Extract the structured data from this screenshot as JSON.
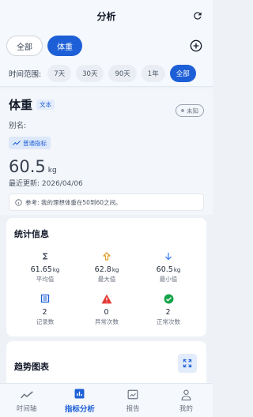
{
  "header": {
    "title": "分析",
    "refresh_icon": "refresh-icon"
  },
  "filters": {
    "tabs": [
      {
        "label": "全部",
        "active": false
      },
      {
        "label": "体重",
        "active": true
      }
    ],
    "add_icon": "add-circle-icon"
  },
  "range": {
    "label": "时间范围:",
    "options": [
      {
        "label": "7天",
        "active": false
      },
      {
        "label": "30天",
        "active": false
      },
      {
        "label": "90天",
        "active": false
      },
      {
        "label": "1年",
        "active": false
      },
      {
        "label": "全部",
        "active": true
      }
    ]
  },
  "indicator": {
    "name": "体重",
    "type_badge": "文本",
    "status": "未知",
    "alias_label": "别名:",
    "category": "普通指标",
    "value": "60.5",
    "unit": "kg",
    "updated": "最近更新: 2026/04/06",
    "note": "参考: 我的理想体重在50到60之间。"
  },
  "stats": {
    "title": "统计信息",
    "items": [
      {
        "icon": "sigma-icon",
        "value": "61.65",
        "unit": "kg",
        "label": "平均值",
        "color": "#4b5563"
      },
      {
        "icon": "arrow-up-icon",
        "value": "62.8",
        "unit": "kg",
        "label": "最大值",
        "color": "#e0a12a"
      },
      {
        "icon": "arrow-down-icon",
        "value": "60.5",
        "unit": "kg",
        "label": "最小值",
        "color": "#3b82f6"
      },
      {
        "icon": "list-icon",
        "value": "2",
        "unit": "",
        "label": "记录数",
        "color": "#1d5fd6"
      },
      {
        "icon": "warning-icon",
        "value": "0",
        "unit": "",
        "label": "异常次数",
        "color": "#e53935"
      },
      {
        "icon": "check-circle-icon",
        "value": "2",
        "unit": "",
        "label": "正常次数",
        "color": "#16a34a"
      }
    ]
  },
  "trend": {
    "title": "趋势图表",
    "expand_icon": "fullscreen-icon"
  },
  "nav": {
    "items": [
      {
        "label": "时间轴",
        "icon": "timeline-icon",
        "active": false
      },
      {
        "label": "指标分析",
        "icon": "bar-chart-icon",
        "active": true
      },
      {
        "label": "报告",
        "icon": "report-icon",
        "active": false
      },
      {
        "label": "我的",
        "icon": "person-icon",
        "active": false
      }
    ]
  },
  "colors": {
    "accent": "#1d5fd6",
    "background": "#eef2f7"
  }
}
